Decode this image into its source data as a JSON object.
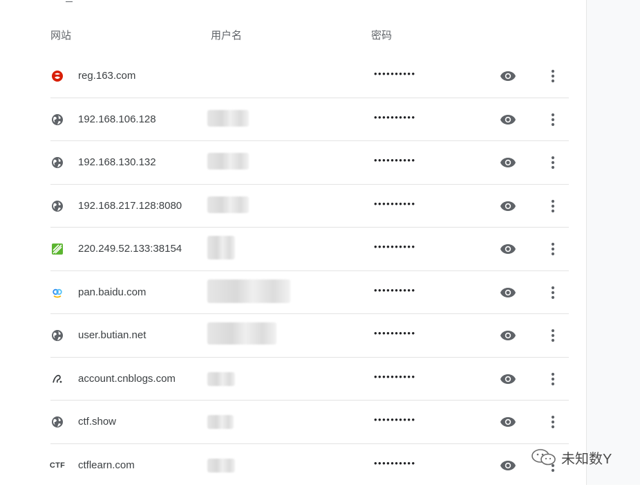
{
  "header": {
    "site_label": "网站",
    "username_label": "用户名",
    "password_label": "密码"
  },
  "rows": [
    {
      "site": "reg.163.com",
      "icon": "netease-icon",
      "password": "••••••••••"
    },
    {
      "site": "192.168.106.128",
      "icon": "globe-icon",
      "password": "••••••••••"
    },
    {
      "site": "192.168.130.132",
      "icon": "globe-icon",
      "password": "••••••••••"
    },
    {
      "site": "192.168.217.128:8080",
      "icon": "globe-icon",
      "password": "••••••••••"
    },
    {
      "site": "220.249.52.133:38154",
      "icon": "leaf-icon",
      "password": "••••••••••"
    },
    {
      "site": "pan.baidu.com",
      "icon": "baidu-pan-icon",
      "password": "••••••••••"
    },
    {
      "site": "user.butian.net",
      "icon": "globe-icon",
      "password": "••••••••••"
    },
    {
      "site": "account.cnblogs.com",
      "icon": "cnblogs-icon",
      "password": "••••••••••"
    },
    {
      "site": "ctf.show",
      "icon": "globe-icon",
      "password": "••••••••••"
    },
    {
      "site": "ctflearn.com",
      "icon": "ctf-icon",
      "password": "••••••••••"
    }
  ],
  "icons": {
    "favicon_ctf_text": "CTF"
  },
  "watermark": {
    "text": "未知数Y"
  },
  "colors": {
    "text": "#3c4043",
    "header": "#5f6368",
    "icon": "#5f6368",
    "divider": "#e3e3e3"
  }
}
